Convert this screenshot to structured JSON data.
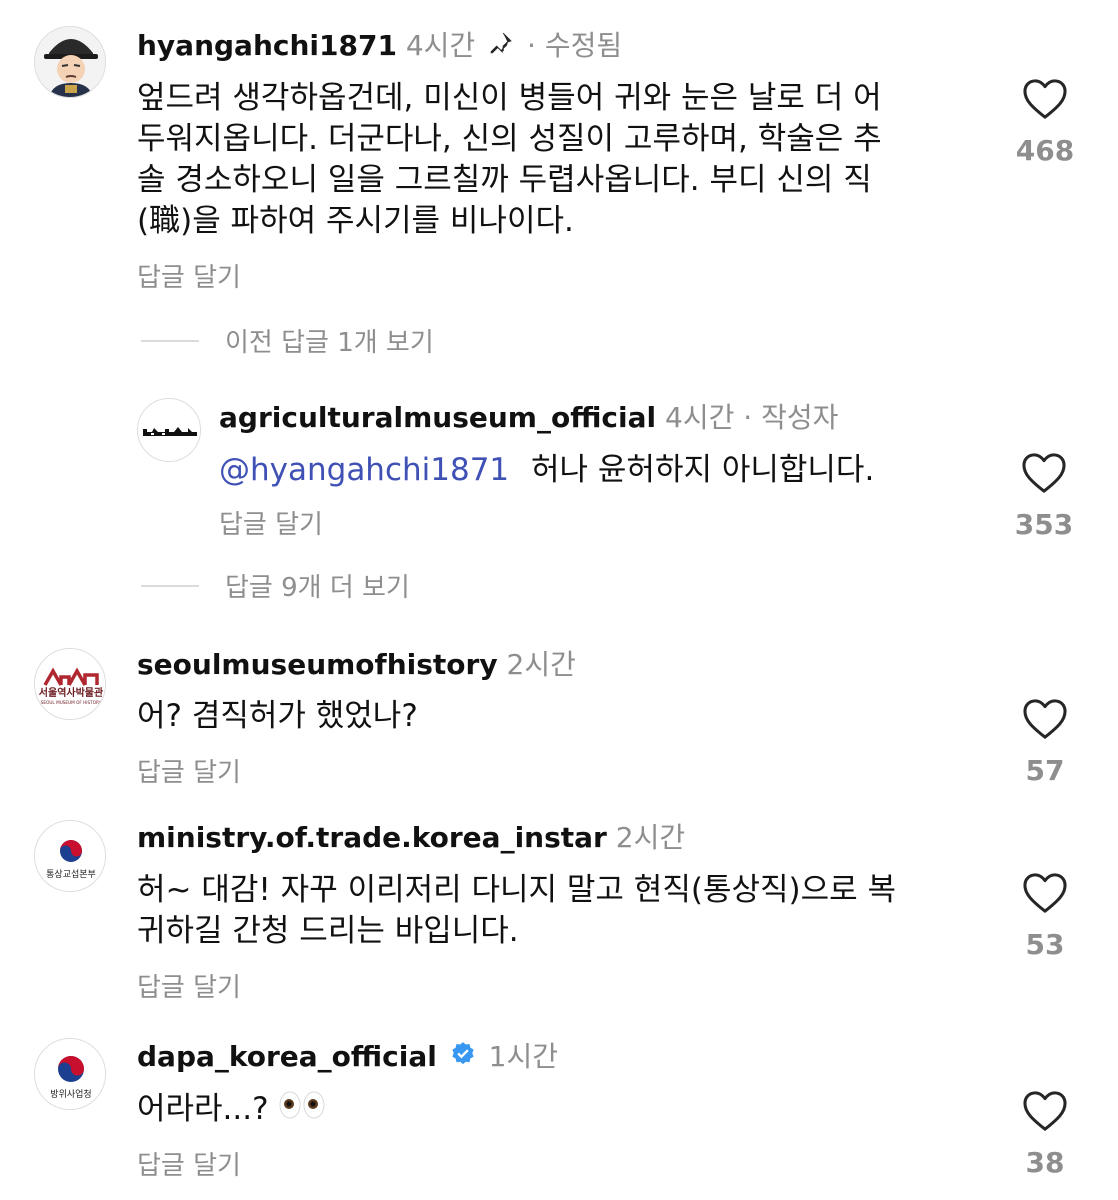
{
  "comments": [
    {
      "username": "hyangahchi1871",
      "time": "4시간",
      "separator": "·",
      "edited": "수정됨",
      "lines": [
        "엎드려 생각하옵건데, 미신이 병들어 귀와 눈은 날로 더 어",
        "두워지옵니다. 더군다나, 신의 성질이  고루하며, 학술은 추",
        "솔 경소하오니 일을 그르칠까 두렵사옵니다. 부디 신의 직",
        "(職)을 파하여 주시기를 비나이다."
      ],
      "reply": "답글 달기",
      "likes": "468"
    },
    {
      "username": "agriculturalmuseum_official",
      "time": "4시간",
      "separator": "·",
      "author": "작성자",
      "mention": "@hyangahchi1871",
      "text": "허나 윤허하지 아니합니다.",
      "reply": "답글 달기",
      "likes": "353"
    },
    {
      "username": "seoulmuseumofhistory",
      "time": "2시간",
      "text": "어? 겸직허가 했었나?",
      "reply": "답글 달기",
      "likes": "57",
      "avatar_text_ko": "서울역사박물관",
      "avatar_text_en": "SEOUL MUSEUM OF HISTORY"
    },
    {
      "username": "ministry.of.trade.korea_instar",
      "time": "2시간",
      "lines": [
        "허~ 대감! 자꾸 이리저리 다니지 말고 현직(통상직)으로 복",
        "귀하길 간청 드리는 바입니다."
      ],
      "reply": "답글 달기",
      "likes": "53",
      "avatar_text": "통상교섭본부"
    },
    {
      "username": "dapa_korea_official",
      "time": "1시간",
      "text": "어라라...?",
      "reply": "답글 달기",
      "likes": "38",
      "avatar_text": "방위사업청"
    }
  ],
  "threads": {
    "view_previous": "이전 답글 1개 보기",
    "view_more": "답글 9개 더 보기"
  },
  "icons": {
    "heart": "heart-icon",
    "pin": "pin-icon",
    "verified": "verified-badge-icon",
    "eyes": "eyes-emoji"
  },
  "colors": {
    "mention": "#3f51b5",
    "verified": "#3897f0",
    "muted": "#8e8e8e"
  }
}
